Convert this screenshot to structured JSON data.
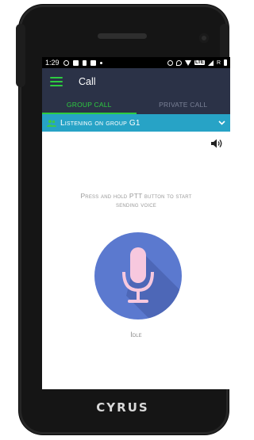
{
  "status_bar": {
    "time": "1:29",
    "lte_label": "LTE",
    "roaming_label": "R"
  },
  "app_bar": {
    "title": "Call",
    "menu_icon": "hamburger-menu-icon"
  },
  "tabs": [
    {
      "label": "GROUP CALL",
      "active": true
    },
    {
      "label": "PRIVATE CALL",
      "active": false
    }
  ],
  "group_bar": {
    "text": "Listening on group G1",
    "icon": "group-people-icon",
    "expand_icon": "chevron-down-icon"
  },
  "content": {
    "instruction": "Press and hold PTT button to start sending voice",
    "status": "Idle",
    "speaker_icon": "speaker-icon",
    "ptt_icon": "microphone-icon"
  },
  "device": {
    "brand": "CYRUS"
  },
  "colors": {
    "app_bar": "#2b3247",
    "accent_green": "#2ecc40",
    "group_bar": "#27a3c6",
    "ptt_button": "#5b79cf",
    "mic": "#f7c8de"
  }
}
